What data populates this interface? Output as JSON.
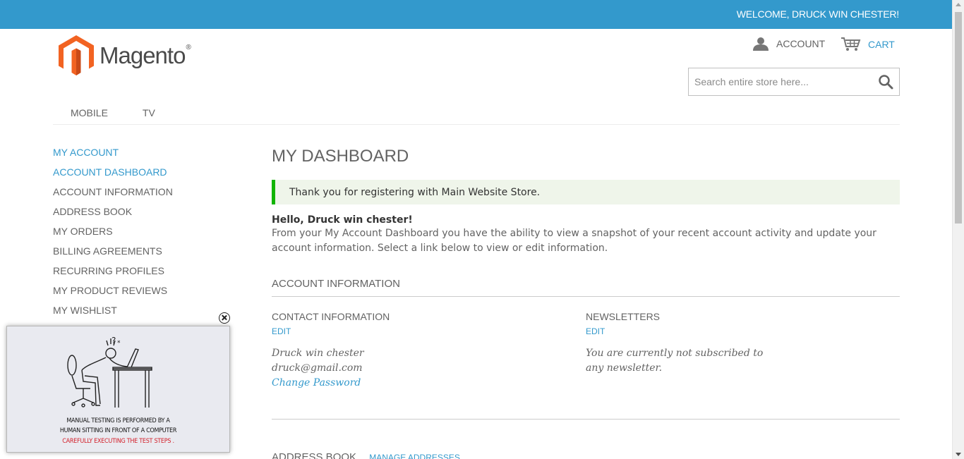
{
  "header": {
    "welcome": "WELCOME, DRUCK WIN CHESTER!",
    "logo_text": "Magento",
    "logo_reg": "®",
    "account_label": "ACCOUNT",
    "cart_label": "CART",
    "search_placeholder": "Search entire store here..."
  },
  "nav": {
    "items": [
      "MOBILE",
      "TV"
    ]
  },
  "sidebar": {
    "heading": "MY ACCOUNT",
    "items": [
      {
        "label": "ACCOUNT DASHBOARD",
        "active": true
      },
      {
        "label": "ACCOUNT INFORMATION"
      },
      {
        "label": "ADDRESS BOOK"
      },
      {
        "label": "MY ORDERS"
      },
      {
        "label": "BILLING AGREEMENTS"
      },
      {
        "label": "RECURRING PROFILES"
      },
      {
        "label": "MY PRODUCT REVIEWS"
      },
      {
        "label": "MY WISHLIST"
      }
    ]
  },
  "main": {
    "title": "MY DASHBOARD",
    "success_message": "Thank you for registering with Main Website Store.",
    "hello": "Hello, Druck win chester!",
    "intro": "From your My Account Dashboard you have the ability to view a snapshot of your recent account activity and update your account information. Select a link below to view or edit information.",
    "account_info_title": "ACCOUNT INFORMATION",
    "contact": {
      "title": "CONTACT INFORMATION",
      "edit": "EDIT",
      "name": "Druck win chester",
      "email": "druck@gmail.com",
      "change_password": "Change Password"
    },
    "newsletters": {
      "title": "NEWSLETTERS",
      "edit": "EDIT",
      "text": "You are currently not subscribed to any newsletter."
    },
    "address_book_title": "ADDRESS BOOK",
    "manage_addresses": "MANAGE ADDRESSES"
  },
  "popup": {
    "caption_line1": "MANUAL TESTING IS PERFORMED BY A",
    "caption_line2": "HUMAN SITTING IN FRONT OF A COMPUTER",
    "caption_line3": "CAREFULLY EXECUTING THE TEST STEPS ."
  },
  "colors": {
    "topbar": "#3399cc",
    "link": "#3399cc",
    "success_border": "#11b400",
    "success_bg": "#eff5ea",
    "logo_orange": "#f26322"
  }
}
